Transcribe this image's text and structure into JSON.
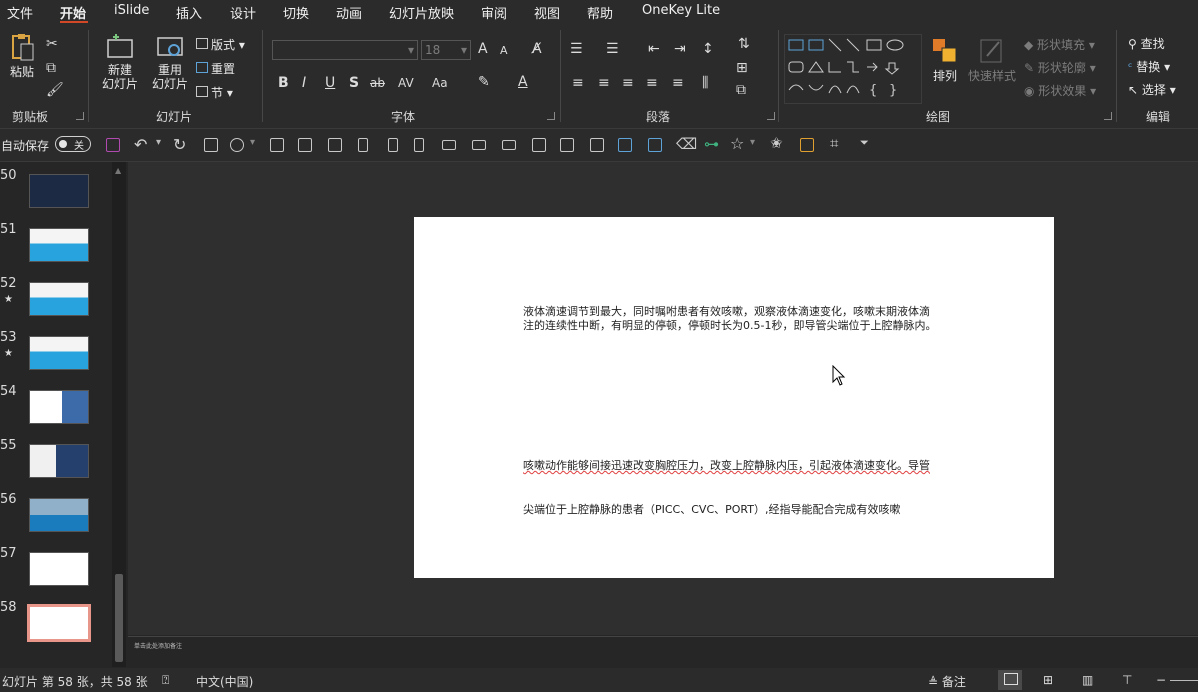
{
  "menu": [
    "文件",
    "开始",
    "iSlide",
    "插入",
    "设计",
    "切换",
    "动画",
    "幻灯片放映",
    "审阅",
    "视图",
    "帮助",
    "OneKey Lite"
  ],
  "ribbon": {
    "clipboard": {
      "paste": "粘贴",
      "group": "剪贴板"
    },
    "slides": {
      "new_slide": "新建\n幻灯片",
      "reuse_slide": "重用\n幻灯片",
      "layout": "版式",
      "reset": "重置",
      "section": "节",
      "group": "幻灯片"
    },
    "font": {
      "size": "18",
      "group": "字体",
      "bold": "B",
      "italic": "I",
      "underline": "U",
      "shadow": "S",
      "strike": "ab",
      "spacing": "AV",
      "case": "Aa",
      "grow": "A",
      "shrink": "A"
    },
    "paragraph": {
      "group": "段落"
    },
    "drawing": {
      "arrange": "排列",
      "quick_styles": "快速样式",
      "shape_fill": "形状填充",
      "shape_outline": "形状轮廓",
      "shape_effects": "形状效果",
      "group": "绘图"
    },
    "editing": {
      "find": "查找",
      "replace": "替换",
      "select": "选择",
      "group": "编辑"
    }
  },
  "qat": {
    "autosave_label": "自动保存",
    "autosave_state": "关"
  },
  "thumbnails": [
    {
      "num": "50",
      "star": false,
      "selected": false
    },
    {
      "num": "51",
      "star": false,
      "selected": false
    },
    {
      "num": "52",
      "star": true,
      "selected": false
    },
    {
      "num": "53",
      "star": true,
      "selected": false
    },
    {
      "num": "54",
      "star": false,
      "selected": false
    },
    {
      "num": "55",
      "star": false,
      "selected": false
    },
    {
      "num": "56",
      "star": false,
      "selected": false
    },
    {
      "num": "57",
      "star": false,
      "selected": false
    },
    {
      "num": "58",
      "star": false,
      "selected": true
    }
  ],
  "slide": {
    "para1_line1": "液体滴速调节到最大，同时嘱咐患者有效咳嗽，观察液体滴速变化，咳嗽末期液体滴",
    "para1_line2": "注的连续性中断，有明显的停顿，停顿时长为0.5-1秒，即导管尖端位于上腔静脉内。",
    "para2_line1": "咳嗽动作能够间接迅速改变胸腔压力，改变上腔静脉内压，引起液体滴速变化。导管",
    "para2_line2": "尖端位于上腔静脉的患者（PICC、CVC、PORT）,经指导能配合完成有效咳嗽"
  },
  "notes_placeholder": "单击此处添加备注",
  "status": {
    "slide_info": "幻灯片 第 58 张，共 58 张",
    "language": "中文(中国)",
    "notes": "备注"
  }
}
